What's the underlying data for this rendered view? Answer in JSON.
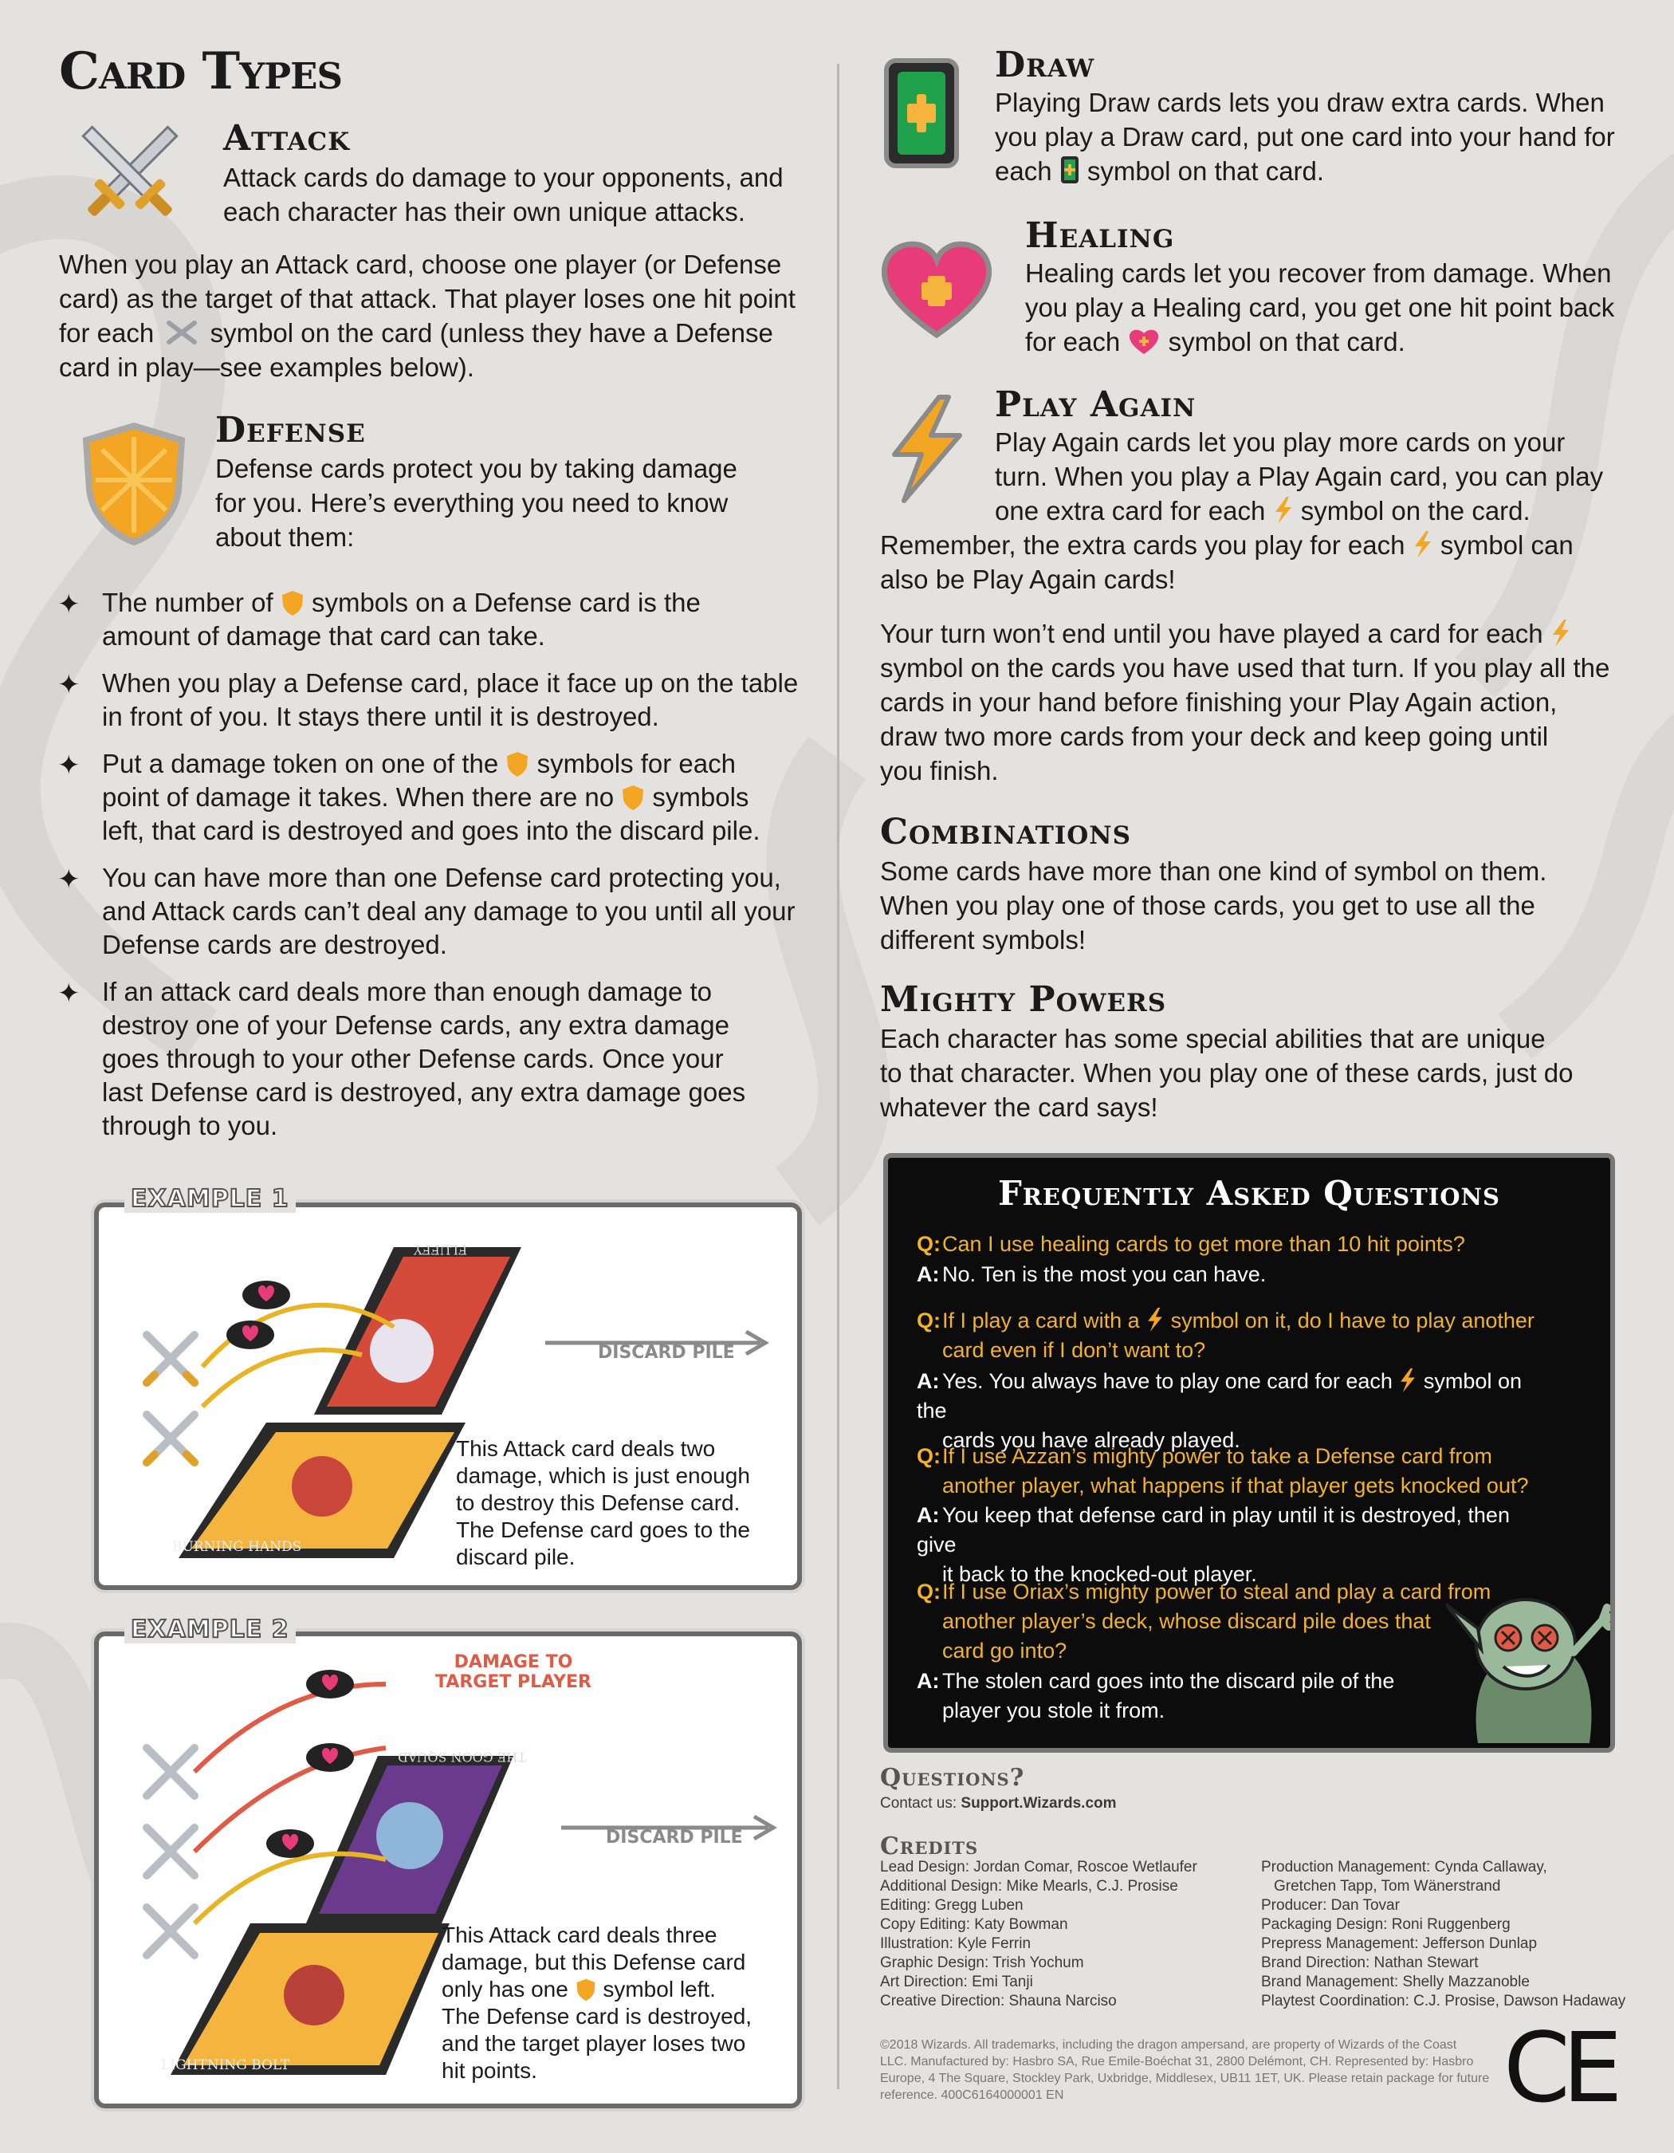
{
  "title": "Card Types",
  "attack": {
    "heading": "Attack",
    "intro_1": "Attack cards do damage to your opponents, and",
    "intro_2": "each character has their own unique attacks.",
    "body_1": "When you play an Attack card, choose one player (or Defense",
    "body_2": "card) as the target of that attack. That player loses one hit point",
    "body_3a": "for each",
    "body_3b": "symbol on the card (unless they have a Defense",
    "body_4": "card in play—see examples below)."
  },
  "defense": {
    "heading": "Defense",
    "intro_1": "Defense cards protect you by taking damage",
    "intro_2": "for you. Here’s everything you need to know",
    "intro_3": "about them:",
    "b1_1a": "The number of",
    "b1_1b": "symbols on a Defense card is the",
    "b1_2": "amount of damage that card can take.",
    "b2_1": "When you play a Defense card, place it face up on the table",
    "b2_2": "in front of you. It stays there until it is destroyed.",
    "b3_1a": "Put a damage token on one of the",
    "b3_1b": "symbols for each",
    "b3_2a": "point of damage it takes. When there are no",
    "b3_2b": "symbols",
    "b3_3": "left, that card is destroyed and goes into the discard pile.",
    "b4_1": "You can have more than one Defense card protecting you,",
    "b4_2": "and Attack cards can’t deal any damage to you until all your",
    "b4_3": "Defense cards are destroyed.",
    "b5_1": "If an attack card deals more than enough damage to",
    "b5_2": "destroy one of your Defense cards, any extra damage",
    "b5_3": "goes through to your other Defense cards. Once your",
    "b5_4": "last Defense card is destroyed, any extra damage goes",
    "b5_5": "through to you."
  },
  "example1": {
    "tag": "EXAMPLE 1",
    "card_top": "FLUFFY",
    "card_bottom": "BURNING HANDS",
    "discard": "DISCARD PILE",
    "cap_1": "This Attack card deals two",
    "cap_2": "damage, which is just enough",
    "cap_3": "to destroy this Defense card.",
    "cap_4": "The Defense card goes to the",
    "cap_5": "discard pile."
  },
  "example2": {
    "tag": "EXAMPLE 2",
    "card_top": "THE GOON SQUAD",
    "card_bottom": "LIGHTNING BOLT",
    "damage_1": "DAMAGE TO",
    "damage_2": "TARGET PLAYER",
    "discard": "DISCARD PILE",
    "cap_1": "This Attack card deals three",
    "cap_2": "damage, but this Defense card",
    "cap_3a": "only has one",
    "cap_3b": "symbol left.",
    "cap_4": "The Defense card is destroyed,",
    "cap_5": "and the target player loses two",
    "cap_6": "hit points."
  },
  "draw": {
    "heading": "Draw",
    "l1": "Playing Draw cards lets you draw extra cards. When",
    "l2": "you play a Draw card, put one card into your hand for",
    "l3a": "each",
    "l3b": "symbol on that card."
  },
  "healing": {
    "heading": "Healing",
    "l1": "Healing cards let you recover from damage. When",
    "l2": "you play a Healing card, you get one hit point back",
    "l3a": "for each",
    "l3b": "symbol on that card."
  },
  "play_again": {
    "heading": "Play Again",
    "l1": "Play Again cards let you play more cards on your",
    "l2": "turn. When you play a Play Again card, you can play",
    "l3a": "one extra card for each",
    "l3b": "symbol on the card.",
    "l4a": "Remember, the extra cards you play for each",
    "l4b": "symbol can",
    "l5": "also be Play Again cards!",
    "p2_1": "Your turn won’t end until you have played a card for each",
    "p2_2": "symbol on the cards you have used that turn. If you play all the",
    "p2_3": "cards in your hand before finishing your Play Again action,",
    "p2_4": "draw two more cards from your deck and keep going until",
    "p2_5": "you finish."
  },
  "combinations": {
    "heading": "Combinations",
    "l1": "Some cards have more than one kind of symbol on them.",
    "l2": "When you play one of those cards, you get to use all the",
    "l3": "different symbols!"
  },
  "mighty": {
    "heading": "Mighty Powers",
    "l1": "Each character has some special abilities that are unique",
    "l2": "to that character. When you play one of these cards, just do",
    "l3": "whatever the card says!"
  },
  "faq": {
    "title": "Frequently Asked Questions",
    "q_label": "Q:",
    "a_label": "A:",
    "q1": "Can I use healing cards to get more than 10 hit points?",
    "a1": "No. Ten is the most you can have.",
    "q2_1a": "If I play a card with a",
    "q2_1b": "symbol on it, do I have to play another",
    "q2_2": "card even if I don’t want to?",
    "a2_1a": "Yes. You always have to play one card for each",
    "a2_1b": "symbol on the",
    "a2_2": "cards you have already played.",
    "q3_1": "If I use Azzan’s mighty power to take a Defense card from",
    "q3_2": "another player, what happens if that player gets knocked out?",
    "a3_1": "You keep that defense card in play until it is destroyed, then give",
    "a3_2": "it back to the knocked-out player.",
    "q4_1": "If I use Oriax’s mighty power to steal and play a card from",
    "q4_2": "another player’s deck, whose discard pile does that",
    "q4_3": "card go into?",
    "a4_1": "The stolen card goes into the discard pile of the",
    "a4_2": "player you stole it from."
  },
  "questions": {
    "heading": "Questions?",
    "contact_label": "Contact us:",
    "contact_value": "Support.Wizards.com"
  },
  "credits": {
    "heading": "Credits",
    "left": [
      "Lead Design: Jordan Comar, Roscoe Wetlaufer",
      "Additional Design: Mike Mearls, C.J. Prosise",
      "Editing: Gregg Luben",
      "Copy Editing: Katy Bowman",
      "Illustration: Kyle Ferrin",
      "Graphic Design: Trish Yochum",
      "Art Direction: Emi Tanji",
      "Creative Direction: Shauna Narciso"
    ],
    "right": [
      "Production Management: Cynda Callaway,",
      "Gretchen Tapp, Tom Wänerstrand",
      "Producer: Dan Tovar",
      "Packaging Design: Roni Ruggenberg",
      "Prepress Management: Jefferson Dunlap",
      "Brand Direction: Nathan Stewart",
      "Brand Management: Shelly Mazzanoble",
      "Playtest Coordination: C.J. Prosise, Dawson Hadaway"
    ]
  },
  "legal": [
    "©2018 Wizards. All trademarks, including the dragon ampersand, are property of Wizards of the Coast",
    "LLC. Manufactured by: Hasbro SA, Rue Emile-Boéchat 31, 2800 Delémont, CH. Represented by: Hasbro",
    "Europe, 4 The Square, Stockley Park, Uxbridge, Middlesex, UB11 1ET, UK. Please retain package for future",
    "reference. 400C6164000001 EN"
  ],
  "ce_mark": "CE",
  "colors": {
    "background": "#e4e2df",
    "faq_question": "#f2b325",
    "faq_panel": "#0c0c0c",
    "damage_red": "#e05a45",
    "attack_arrow": "#e8b423",
    "shield_gold": "#f2a623",
    "draw_green": "#21a14b",
    "heart_pink": "#e83b7a"
  },
  "icons": [
    "crossed-swords-icon",
    "shield-icon",
    "draw-card-icon",
    "heart-icon",
    "lightning-icon",
    "star-bullet-icon",
    "heartbreak-token-icon",
    "goblin-illustration",
    "ce-mark"
  ]
}
